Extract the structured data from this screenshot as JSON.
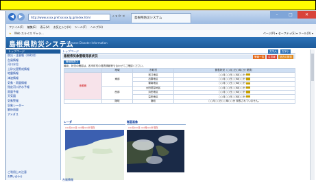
{
  "browser": {
    "url": "http://www.xxxx.pref.xxxxx.lg.jp/index.html",
    "tab_title": "島根県防災システム",
    "menu": [
      "ファイル(F)",
      "編集(E)",
      "表示(V)",
      "お気に入り(A)",
      "ツール(T)",
      "ヘルプ(H)"
    ],
    "favorites_label": "Web スライス ギャラ...",
    "toolbar_right": "ページ(P) ▾ セーフティ(S) ▾ ツール(O) ▾"
  },
  "site": {
    "title": "島根県防災システム",
    "subtitle": "Shimane Disaster Information"
  },
  "sidebar": {
    "header": "トップページ",
    "items": [
      "防災・注意報（市町村）",
      "台風情報",
      "河川水位",
      "土砂災害警戒情報",
      "地震情報",
      "津波情報",
      "気象・雨量情報",
      "指定河川洪水予報",
      "雨量予報",
      "天気図",
      "気象警報",
      "気象レーダー",
      "解析雨量",
      "アメダス"
    ],
    "footer": "ご利用上の注意",
    "footer2": "お問い合わせ"
  },
  "main": {
    "breadcrumb": "トップページ",
    "buttons": [
      "文字大",
      "文字小"
    ],
    "section_title": "島根県気象警報発表状況",
    "section_buttons": [
      "警報一覧",
      "注意報",
      "過去の発表"
    ],
    "subbar": "警報発表中",
    "notice": "最新、状況の確認は、各市町村の発表情報等も合わせてご確認ください。",
    "table": {
      "headers": [
        "地域",
        "市町村",
        "発表状況（○月○日○時○分 発表）"
      ],
      "group_a": "東部",
      "group_b": "西部",
      "group_c": "隠岐",
      "region_label": "島根県",
      "rows": [
        {
          "city": "松江地区",
          "time": "○○月○○日○○時○○分"
        },
        {
          "city": "出雲地区",
          "time": "○○月○○日○○時○○分"
        },
        {
          "city": "雲南地区",
          "time": "○○月○○日○○時○○分"
        },
        {
          "city": "大田邑智地区",
          "time": "○○月○○日○○時○○分"
        },
        {
          "city": "浜田地区",
          "time": "○○月○○日○○時○○分"
        },
        {
          "city": "益田地区",
          "time": "○○月○○日○○時○○分"
        },
        {
          "city": "隠岐",
          "time": "○○月○○日○○時○○分",
          "status": "発表されていません。"
        }
      ]
    },
    "panel_radar": "レーダ",
    "panel_radar_note": "○○月○○日 ○○時○○分 現在",
    "panel_sat": "衛星画像",
    "panel_sat_note": "○○月○○日 ○○時○○分 現在",
    "bottom_head": "台風情報"
  }
}
